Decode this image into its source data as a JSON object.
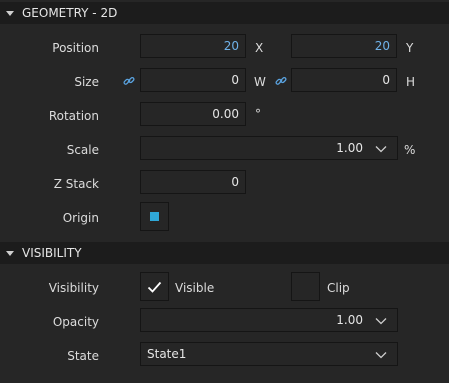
{
  "sections": {
    "geometry": {
      "title": "GEOMETRY - 2D"
    },
    "visibility": {
      "title": "VISIBILITY"
    }
  },
  "geometry": {
    "position": {
      "label": "Position",
      "x": "20",
      "x_unit": "X",
      "y": "20",
      "y_unit": "Y"
    },
    "size": {
      "label": "Size",
      "w": "0",
      "w_unit": "W",
      "h": "0",
      "h_unit": "H",
      "icon": "link-icon"
    },
    "rotation": {
      "label": "Rotation",
      "value": "0.00",
      "unit": "°"
    },
    "scale": {
      "label": "Scale",
      "value": "1.00",
      "unit": "%"
    },
    "z_stack": {
      "label": "Z Stack",
      "value": "0"
    },
    "origin": {
      "label": "Origin",
      "color": "#2fa8d8"
    }
  },
  "visibility": {
    "visibility": {
      "label": "Visibility",
      "visible_label": "Visible",
      "visible_checked": true,
      "clip_label": "Clip",
      "clip_checked": false
    },
    "opacity": {
      "label": "Opacity",
      "value": "1.00"
    },
    "state": {
      "label": "State",
      "value": "State1"
    }
  },
  "colors": {
    "accent": "#6fb1e8",
    "origin_marker": "#2fa8d8"
  }
}
